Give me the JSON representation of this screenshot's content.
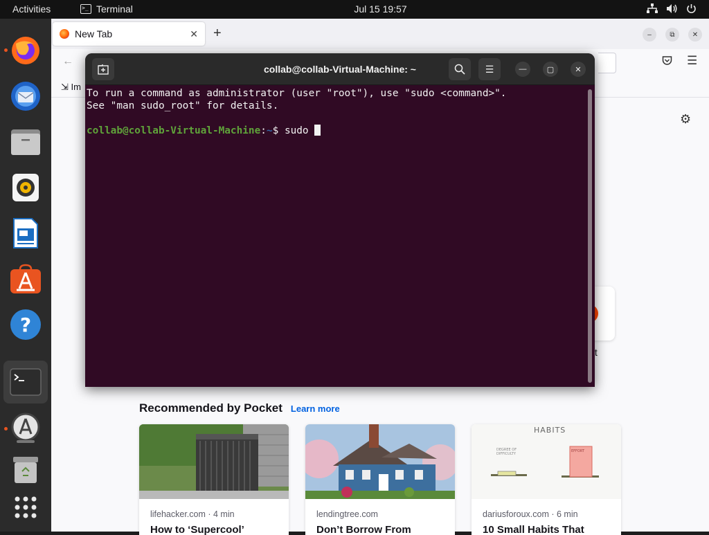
{
  "topbar": {
    "activities": "Activities",
    "app_name": "Terminal",
    "clock": "Jul 15  19:57",
    "tray_icons": [
      "network-icon",
      "volume-icon",
      "power-icon"
    ]
  },
  "dock": {
    "items": [
      {
        "name": "firefox",
        "running": true
      },
      {
        "name": "thunderbird",
        "running": false
      },
      {
        "name": "files",
        "running": false
      },
      {
        "name": "rhythmbox",
        "running": false
      },
      {
        "name": "libreoffice-writer",
        "running": false
      },
      {
        "name": "ubuntu-software",
        "running": false
      },
      {
        "name": "help",
        "running": false
      },
      {
        "name": "terminal",
        "running": true,
        "active": true
      },
      {
        "name": "software-updater",
        "running": true
      },
      {
        "name": "trash",
        "running": false
      },
      {
        "name": "show-applications",
        "running": false
      }
    ]
  },
  "browser": {
    "tab_title": "New Tab",
    "bookmark_partial": "Im",
    "shortcut_label_partial": "dit",
    "pocket": {
      "heading": "Recommended by Pocket",
      "learn_more": "Learn more",
      "cards": [
        {
          "source": "lifehacker.com · 4 min",
          "headline": "How to ‘Supercool’"
        },
        {
          "source": "lendingtree.com",
          "headline": "Don’t Borrow From"
        },
        {
          "source": "dariusforoux.com · 6 min",
          "headline": "10 Small Habits That"
        }
      ],
      "card3_image_title": "HABITS"
    }
  },
  "terminal": {
    "title": "collab@collab-Virtual-Machine: ~",
    "lines": {
      "line1": "To run a command as administrator (user \"root\"), use \"sudo <command>\".",
      "line2": "See \"man sudo_root\" for details.",
      "prompt_user": "collab@collab-Virtual-Machine",
      "prompt_sep": ":",
      "prompt_path": "~",
      "prompt_dollar": "$ ",
      "command": "sudo "
    }
  },
  "colors": {
    "terminal_bg": "#300a24",
    "ubuntu_orange": "#e95420",
    "prompt_green": "#5fa33a",
    "prompt_blue": "#3465a4"
  }
}
